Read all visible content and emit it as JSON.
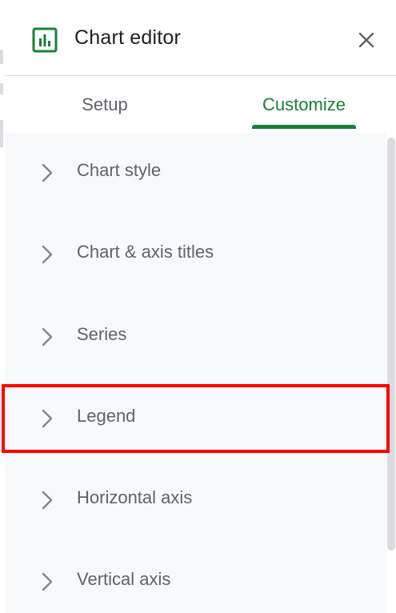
{
  "header": {
    "title": "Chart editor",
    "icon": "bar-chart-icon",
    "close_icon": "close-icon"
  },
  "tabs": [
    {
      "label": "Setup",
      "active": false
    },
    {
      "label": "Customize",
      "active": true
    }
  ],
  "sections": [
    {
      "label": "Chart style",
      "icon": "chevron-right-icon"
    },
    {
      "label": "Chart & axis titles",
      "icon": "chevron-right-icon"
    },
    {
      "label": "Series",
      "icon": "chevron-right-icon"
    },
    {
      "label": "Legend",
      "icon": "chevron-right-icon",
      "highlighted": true
    },
    {
      "label": "Horizontal axis",
      "icon": "chevron-right-icon"
    },
    {
      "label": "Vertical axis",
      "icon": "chevron-right-icon"
    }
  ],
  "colors": {
    "accent": "#188038",
    "highlight": "#ff0000",
    "panel_background": "#f8f9fa",
    "text_secondary": "#5f6368"
  }
}
